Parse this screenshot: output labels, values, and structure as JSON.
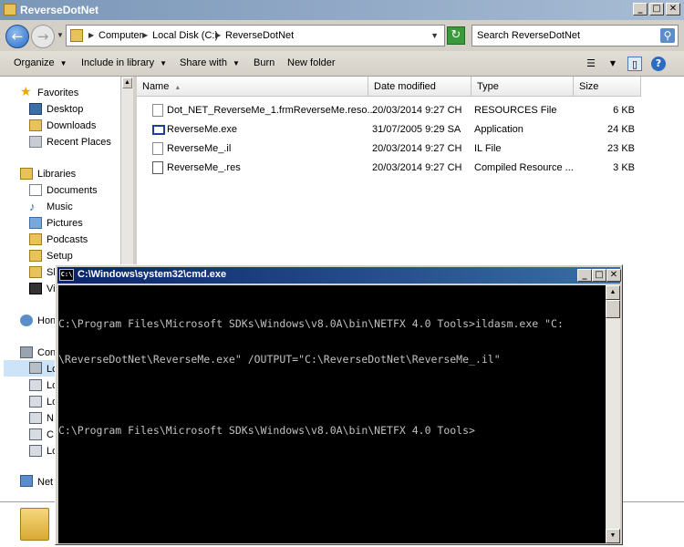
{
  "explorer": {
    "title": "ReverseDotNet",
    "window_buttons": {
      "minimize": "_",
      "maximize": "□",
      "close": "✕"
    },
    "address": {
      "crumbs": [
        "Computer",
        "Local Disk (C:)",
        "ReverseDotNet"
      ],
      "search_placeholder": "Search ReverseDotNet"
    },
    "toolbar": {
      "organize": "Organize",
      "include_in_library": "Include in library",
      "share_with": "Share with",
      "burn": "Burn",
      "new_folder": "New folder"
    },
    "nav": {
      "favorites_header": "Favorites",
      "favorites": [
        "Desktop",
        "Downloads",
        "Recent Places"
      ],
      "libraries_header": "Libraries",
      "libraries": [
        "Documents",
        "Music",
        "Pictures",
        "Podcasts",
        "Setup",
        "Sl",
        "Vi"
      ],
      "homegroup": "Hon",
      "computer_header": "Con",
      "computer_items": [
        "Lo",
        "Lo",
        "Lo",
        "N",
        "C",
        "Lo"
      ],
      "network": "Net"
    },
    "columns": {
      "name": "Name",
      "date_modified": "Date modified",
      "type": "Type",
      "size": "Size"
    },
    "files": [
      {
        "name": "Dot_NET_ReverseMe_1.frmReverseMe.reso...",
        "date": "20/03/2014 9:27 CH",
        "type": "RESOURCES File",
        "size": "6 KB",
        "icon": "generic-file"
      },
      {
        "name": "ReverseMe.exe",
        "date": "31/07/2005 9:29 SA",
        "type": "Application",
        "size": "24 KB",
        "icon": "application"
      },
      {
        "name": "ReverseMe_.il",
        "date": "20/03/2014 9:27 CH",
        "type": "IL File",
        "size": "23 KB",
        "icon": "generic-file"
      },
      {
        "name": "ReverseMe_.res",
        "date": "20/03/2014 9:27 CH",
        "type": "Compiled Resource ...",
        "size": "3 KB",
        "icon": "resource-file"
      }
    ]
  },
  "cmd": {
    "title": "C:\\Windows\\system32\\cmd.exe",
    "icon_text": "C:\\",
    "lines": [
      "C:\\Program Files\\Microsoft SDKs\\Windows\\v8.0A\\bin\\NETFX 4.0 Tools>ildasm.exe \"C:",
      "\\ReverseDotNet\\ReverseMe.exe\" /OUTPUT=\"C:\\ReverseDotNet\\ReverseMe_.il\"",
      "",
      "C:\\Program Files\\Microsoft SDKs\\Windows\\v8.0A\\bin\\NETFX 4.0 Tools>"
    ]
  },
  "colors": {
    "titlebar": "#7a96b8",
    "cmd_titlebar": "#0a246a",
    "cmd_background": "#000000",
    "cmd_text": "#c0c0c0",
    "selection": "#cde3f7"
  }
}
